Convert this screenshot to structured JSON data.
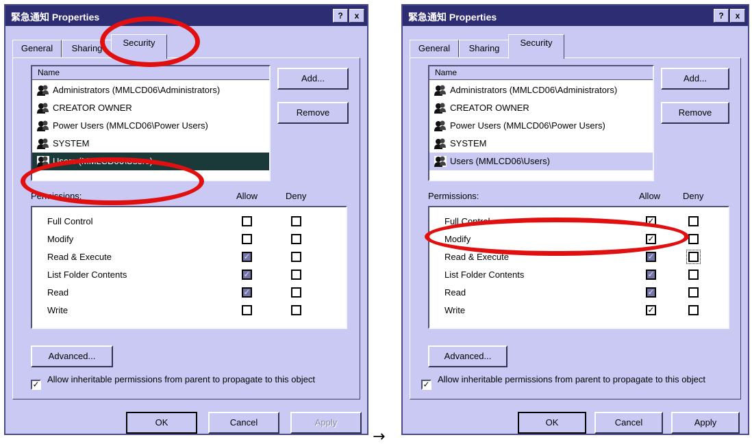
{
  "dialog_title_chinese": "緊急通知",
  "dialog_title_suffix": "Properties",
  "titlebar_buttons": {
    "help": "?",
    "close": "x"
  },
  "tabs": [
    "General",
    "Sharing",
    "Security"
  ],
  "name_header": "Name",
  "names": [
    "Administrators (MMLCD06\\Administrators)",
    "CREATOR OWNER",
    "Power Users (MMLCD06\\Power Users)",
    "SYSTEM",
    "Users (MMLCD06\\Users)"
  ],
  "buttons": {
    "add": "Add...",
    "remove": "Remove",
    "advanced": "Advanced...",
    "ok": "OK",
    "cancel": "Cancel",
    "apply": "Apply"
  },
  "permissions_label": "Permissions:",
  "allow_header": "Allow",
  "deny_header": "Deny",
  "permissions": [
    "Full Control",
    "Modify",
    "Read & Execute",
    "List Folder Contents",
    "Read",
    "Write"
  ],
  "inherit_text": "Allow inheritable permissions from parent to propagate to this object",
  "arrow": "→",
  "colors": {
    "highlight": "#e01010",
    "dialog_bg": "#c9c9f3",
    "titlebar": "#2d2d74",
    "selection": "#1a3a3a"
  },
  "icons": {
    "user": "users-group-icon",
    "check": "checkmark-icon"
  },
  "state": {
    "before": {
      "selected_user": "Users (MMLCD06\\Users)",
      "allow": [
        "empty",
        "empty",
        "inherited",
        "inherited",
        "inherited",
        "empty"
      ],
      "deny": [
        "empty",
        "empty",
        "empty",
        "empty",
        "empty",
        "empty"
      ],
      "apply_enabled": false
    },
    "after": {
      "selected_user": "Users (MMLCD06\\Users)",
      "allow": [
        "checked",
        "checked",
        "inherited",
        "inherited",
        "inherited",
        "checked"
      ],
      "deny": [
        "empty",
        "empty",
        "empty",
        "empty",
        "empty",
        "empty"
      ],
      "apply_enabled": true
    }
  }
}
